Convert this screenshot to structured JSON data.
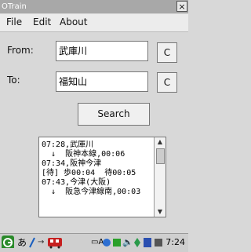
{
  "window": {
    "title": "OTrain",
    "close_label": "×"
  },
  "menu": {
    "file": "File",
    "edit": "Edit",
    "about": "About"
  },
  "form": {
    "from_label": "From:",
    "from_value": "武庫川",
    "to_label": "To:",
    "to_value": "福知山",
    "clear_label": "C",
    "search_label": "Search"
  },
  "results": {
    "lines": [
      "07:28,武庫川",
      "  ↓  阪神本線,00:06",
      "07:34,阪神今津",
      "[待] 歩00:04  待00:05",
      "07:43,今津(大阪)",
      "  ↓  阪急今津線南,00:03"
    ]
  },
  "taskbar": {
    "input_mode": "あ",
    "time": "7:24"
  },
  "colors": {
    "app_bg": "#d8d8d8",
    "title_bg": "#a8a8a8",
    "menu_bg": "#ececec"
  }
}
